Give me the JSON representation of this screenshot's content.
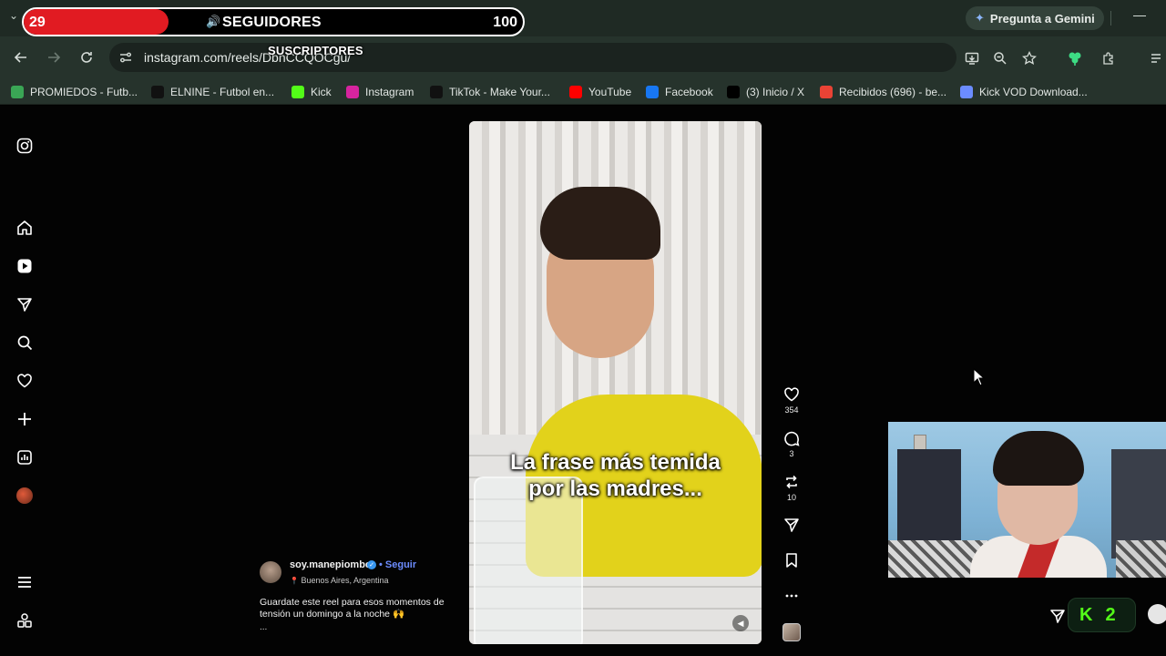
{
  "overlay": {
    "followers_count": "29",
    "followers_label": "SEGUIDORES",
    "followers_goal": "100",
    "followers_progress_fraction": 0.29,
    "subscribers_label": "SUSCRIPTORES"
  },
  "browser": {
    "gemini_label": "Pregunta a Gemini",
    "url": "instagram.com/reels/DbnCCQOCgu/"
  },
  "bookmarks": [
    {
      "label": "PROMIEDOS - Futb...",
      "icon": "promiedos-icon",
      "color": "#3aa655"
    },
    {
      "label": "ELNINE - Futbol en...",
      "icon": "elnine-icon",
      "color": "#111111"
    },
    {
      "label": "Kick",
      "icon": "kick-icon",
      "color": "#53fc18"
    },
    {
      "label": "Instagram",
      "icon": "instagram-icon",
      "color": "#d6249f"
    },
    {
      "label": "TikTok - Make Your...",
      "icon": "tiktok-icon",
      "color": "#111111"
    },
    {
      "label": "YouTube",
      "icon": "youtube-icon",
      "color": "#ff0000"
    },
    {
      "label": "Facebook",
      "icon": "facebook-icon",
      "color": "#1877f2"
    },
    {
      "label": "(3) Inicio / X",
      "icon": "x-icon",
      "color": "#000000"
    },
    {
      "label": "Recibidos (696) - be...",
      "icon": "gmail-icon",
      "color": "#ea4335"
    },
    {
      "label": "Kick VOD Download...",
      "icon": "kick-vod-icon",
      "color": "#6b8cff"
    }
  ],
  "reel": {
    "caption_line1": "La frase más temida",
    "caption_line2": "por las madres...",
    "likes": "354",
    "comments": "3",
    "reposts": "10"
  },
  "author": {
    "username": "soy.manepiombo",
    "follow_label": "• Seguir",
    "location": "Buenos Aires, Argentina",
    "description": "Guardate este reel para esos momentos de tensión un domingo a la noche 🙌",
    "more_label": "..."
  },
  "kick_widget": {
    "count": "2"
  },
  "colors": {
    "overlay_red": "#e11b22",
    "kick_green": "#53fc18",
    "instagram_link_blue": "#6c8cff"
  }
}
